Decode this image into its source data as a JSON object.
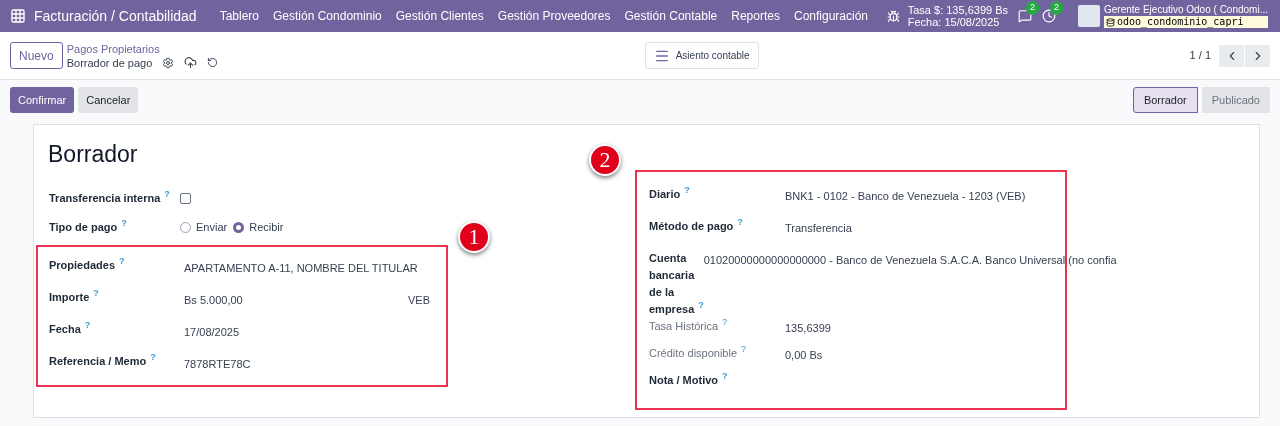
{
  "navbar": {
    "app_title": "Facturación / Contabilidad",
    "menu": [
      "Tablero",
      "Gestión Condominio",
      "Gestión Clientes",
      "Gestión Proveedores",
      "Gestión Contable",
      "Reportes",
      "Configuración"
    ],
    "rate": "Tasa $: 135,6399 Bs",
    "date": "Fecha: 15/08/2025",
    "messages_count": "2",
    "activities_count": "2",
    "user": "Gerente Ejecutivo Odoo ( Condomi...",
    "database": "odoo_condominio_capri"
  },
  "control_panel": {
    "new_button": "Nuevo",
    "breadcrumb": "Pagos Propietarios",
    "record": "Borrador de pago",
    "smart_button": "Asiento contable",
    "pager": "1 / 1"
  },
  "actions": {
    "buttons": [
      {
        "label": "Confirmar",
        "kind": "primary"
      },
      {
        "label": "Cancelar",
        "kind": "secondary"
      }
    ],
    "status": [
      {
        "label": "Borrador",
        "selected": true
      },
      {
        "label": "Publicado",
        "selected": false
      }
    ]
  },
  "form": {
    "title": "Borrador",
    "top_fields": [
      {
        "kind": "checkbox",
        "label": "Transferencia interna",
        "help": "?",
        "checked": false
      },
      {
        "kind": "radio",
        "label": "Tipo de pago",
        "help": "?",
        "options": [
          {
            "label": "Enviar",
            "selected": false
          },
          {
            "label": "Recibir",
            "selected": true
          }
        ]
      }
    ],
    "group_1": {
      "callout": "1",
      "fields": [
        {
          "label": "Propiedades",
          "help": "?",
          "value": "APARTAMENTO A-11, NOMBRE DEL TITULAR"
        },
        {
          "label": "Importe",
          "help": "?",
          "value": "Bs 5.000,00",
          "currency": "VEB"
        },
        {
          "label": "Fecha",
          "help": "?",
          "value": "17/08/2025"
        },
        {
          "label": "Referencia / Memo",
          "help": "?",
          "value": "7878RTE78C"
        }
      ]
    },
    "group_2": {
      "callout": "2",
      "fields": [
        {
          "label": "Diario",
          "help": "?",
          "value": "BNK1 - 0102 - Banco de Venezuela - 1203 (VEB)",
          "muted": false
        },
        {
          "label": "Método de pago",
          "help": "?",
          "value": "Transferencia",
          "muted": false
        },
        {
          "label": "Cuenta bancaria de la empresa",
          "help": "?",
          "value": "01020000000000000000 - Banco de Venezuela S.A.C.A. Banco Universal (no confia",
          "muted": false
        },
        {
          "label": "Tasa Histórica",
          "help": "?",
          "value": "135,6399",
          "muted": true
        },
        {
          "label": "Crédito disponible",
          "help": "?",
          "value": "0,00 Bs",
          "muted": true
        },
        {
          "label": "Nota / Motivo",
          "help": "?",
          "muted": false
        }
      ]
    }
  }
}
